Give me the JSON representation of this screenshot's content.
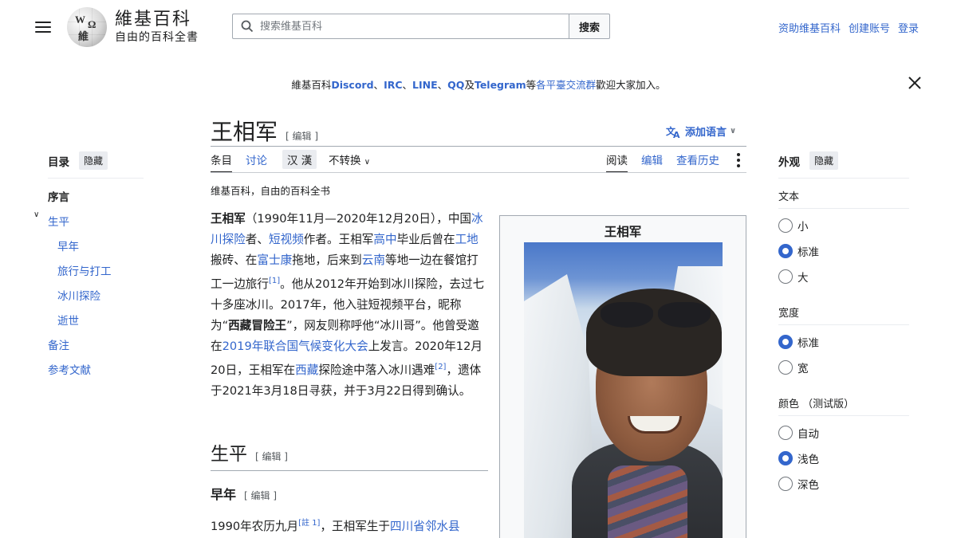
{
  "header": {
    "logo_title": "維基百科",
    "logo_subtitle": "自由的百科全書",
    "search_placeholder": "搜索维基百科",
    "search_button": "搜索",
    "user_links": [
      "资助维基百科",
      "创建账号",
      "登录"
    ]
  },
  "banner": {
    "parts": [
      "維基百科",
      "Discord",
      "、",
      "IRC",
      "、",
      "LINE",
      "、",
      "QQ",
      "及",
      "Telegram",
      "等",
      "各平臺交流群",
      "歡迎大家加入。"
    ]
  },
  "toc": {
    "title": "目录",
    "hide": "隐藏",
    "items": [
      "序言",
      "生平",
      "早年",
      "旅行与打工",
      "冰川探险",
      "逝世",
      "备注",
      "参考文献"
    ]
  },
  "article": {
    "title": "王相军",
    "edit": "[ 编辑 ]",
    "add_languages": "添加语言",
    "tabs": {
      "article": "条目",
      "talk": "讨论",
      "variant_a": "汉",
      "variant_b": "漢",
      "no_convert": "不转换",
      "read": "阅读",
      "edit": "编辑",
      "history": "查看历史"
    },
    "from": "维基百科，自由的百科全书",
    "section_h2": "生平",
    "section_h3": "早年",
    "section_edit": "[ 编辑 ]",
    "lead": {
      "s1": "王相军",
      "s2": "（1990年11月—2020年12月20日），中国",
      "l1": "冰川探险",
      "s3": "者、",
      "l2": "短视频",
      "s4": "作者。王相军",
      "l3": "高中",
      "s5": "毕业后曾在",
      "l4": "工地",
      "s6": "搬砖、在",
      "l5": "富士康",
      "s7": "拖地，后来到",
      "l6": "云南",
      "s8": "等地一边在餐馆打工一边旅行",
      "ref1": "[1]",
      "s9": "。他从2012年开始到冰川探险，去过七十多座冰川。2017年，他入驻短视频平台，昵称为“",
      "nick": "西藏冒险王",
      "s10": "”，网友则称呼他“冰川哥”。他曾受邀在",
      "l7": "2019年联合国气候变化大会",
      "s11": "上发言。2020年12月20日，王相军在",
      "l8": "西藏",
      "s12": "探险途中落入冰川遇难",
      "ref2": "[2]",
      "s13": "，遗体于2021年3月18日寻获，并于3月22日得到确认。"
    },
    "tail": {
      "s1": "1990年农历九月",
      "note": "[註 1]",
      "s2": "，王相军生于",
      "l1": "四川省邻水县"
    }
  },
  "infobox": {
    "title": "王相军"
  },
  "appearance": {
    "title": "外观",
    "hide": "隐藏",
    "text_label": "文本",
    "text_options": [
      "小",
      "标准",
      "大"
    ],
    "text_selected": "标准",
    "width_label": "宽度",
    "width_options": [
      "标准",
      "宽"
    ],
    "width_selected": "标准",
    "color_label": "颜色 （测试版）",
    "color_options": [
      "自动",
      "浅色",
      "深色"
    ],
    "color_selected": "浅色"
  }
}
